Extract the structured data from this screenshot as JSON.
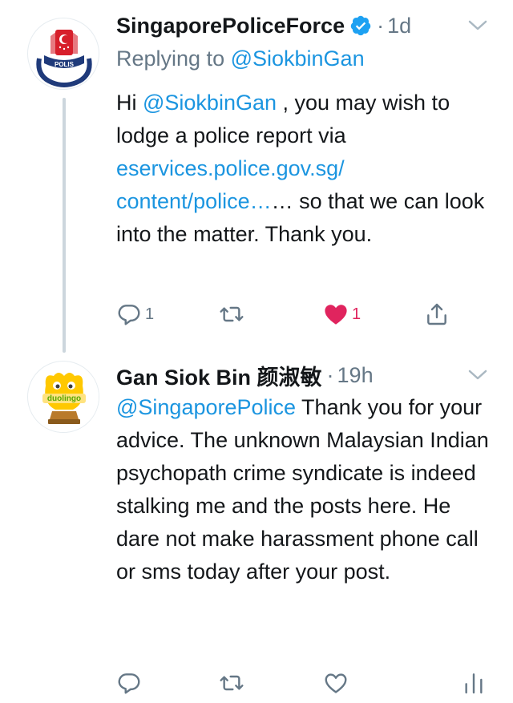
{
  "tweets": [
    {
      "author_name": "SingaporePoliceForce",
      "verified": true,
      "separator": "·",
      "time": "1d",
      "replying_prefix": "Replying to ",
      "replying_handle": "@SiokbinGan",
      "body": {
        "t0": "Hi ",
        "mention": "@SiokbinGan",
        "t1": " , you may wish to lodge a police report via ",
        "link1": "eservices.police.gov.sg/",
        "link2": "content/police…",
        "t2": "… so that we can look into the matter. Thank you."
      },
      "reply_count": "1",
      "like_count": "1",
      "liked": true
    },
    {
      "author_name": "Gan Siok Bin 颜淑敏",
      "separator": "·",
      "time": "19h",
      "body": {
        "mention": "@SingaporePolice",
        "t1": " Thank you for your advice. The unknown Malaysian Indian psychopath crime syndicate is indeed stalking me and the posts here. He dare not make harassment phone call or sms today after your post."
      }
    }
  ],
  "avatar_text": {
    "police": "POLIS",
    "duolingo": "duolingo"
  },
  "icons": {
    "reply": "reply-icon",
    "retweet": "retweet-icon",
    "like": "heart-icon",
    "share": "share-icon",
    "analytics": "analytics-icon",
    "caret": "chevron-down-icon",
    "verified": "verified-badge-icon"
  },
  "colors": {
    "link": "#1b95e0",
    "text": "#14171a",
    "muted": "#657786",
    "like": "#e0245e",
    "verified": "#1da1f2",
    "thread_line": "#ccd6dd"
  }
}
